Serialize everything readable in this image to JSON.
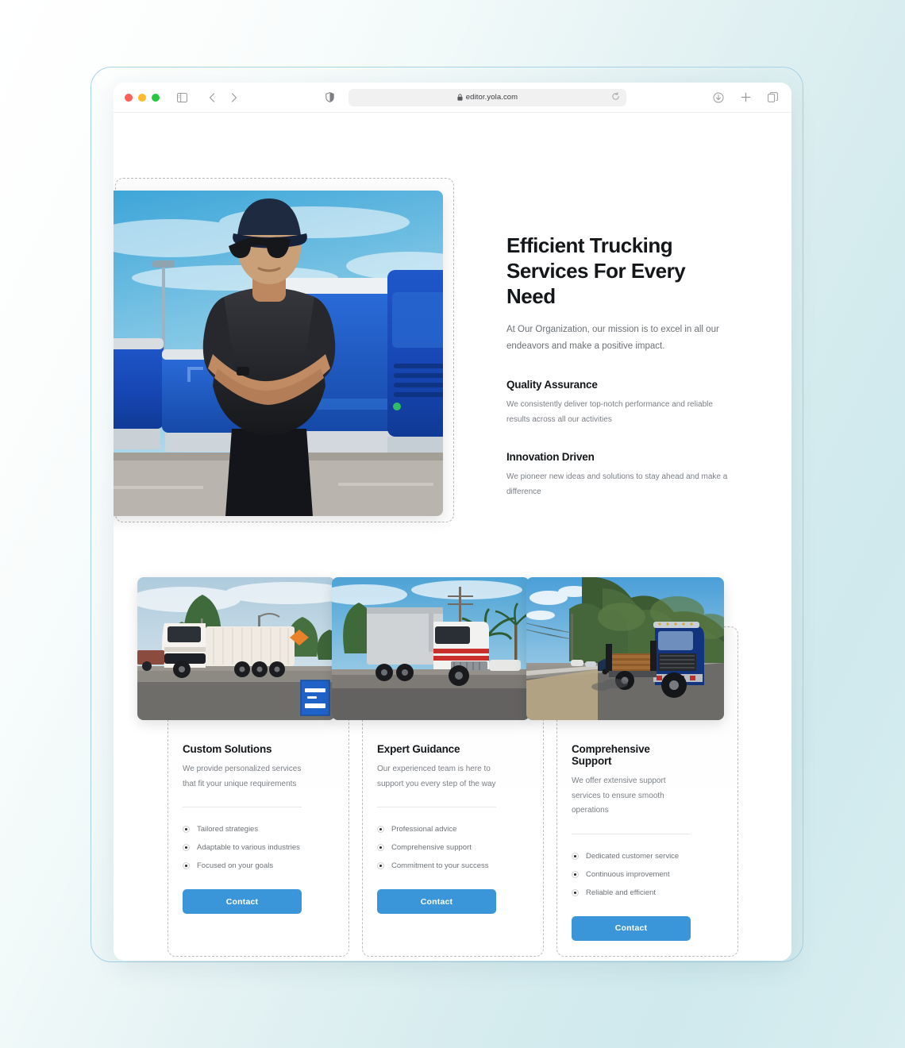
{
  "browser": {
    "url": "editor.yola.com",
    "icons": {
      "sidebar": "sidebar-icon",
      "back": "chevron-left-icon",
      "forward": "chevron-right-icon",
      "shield": "shield-icon",
      "lock": "lock-icon",
      "reload": "reload-icon",
      "download": "download-icon",
      "new_tab": "plus-icon",
      "tabs": "copy-tabs-icon"
    }
  },
  "hero": {
    "title": "Efficient Trucking Services For Every Need",
    "subtitle": "At Our Organization, our mission is to excel in all our endeavors and make a positive impact.",
    "image_alt": "truck-driver-photo",
    "features": [
      {
        "title": "Quality Assurance",
        "desc": "We consistently deliver top-notch performance and reliable results across all our activities"
      },
      {
        "title": "Innovation Driven",
        "desc": "We pioneer new ideas and solutions to stay ahead and make a difference"
      }
    ]
  },
  "cards": [
    {
      "image_alt": "white-semi-truck-photo",
      "title": "Custom Solutions",
      "desc": "We provide personalized services that fit your unique requirements",
      "items": [
        "Tailored strategies",
        "Adaptable to various industries",
        "Focused on your goals"
      ],
      "button": "Contact"
    },
    {
      "image_alt": "red-striped-truck-photo",
      "title": "Expert Guidance",
      "desc": "Our experienced team is here to support you every step of the way",
      "items": [
        "Professional advice",
        "Comprehensive support",
        "Commitment to your success"
      ],
      "button": "Contact"
    },
    {
      "image_alt": "blue-flatbed-truck-photo",
      "title": "Comprehensive Support",
      "desc": "We offer extensive support services to ensure smooth operations",
      "items": [
        "Dedicated customer service",
        "Continuous improvement",
        "Reliable and efficient"
      ],
      "button": "Contact"
    }
  ],
  "colors": {
    "accent": "#3b96d9",
    "heading": "#14171a",
    "body_text": "#7a7f85",
    "page_bg_right": "#cfe9ed"
  }
}
